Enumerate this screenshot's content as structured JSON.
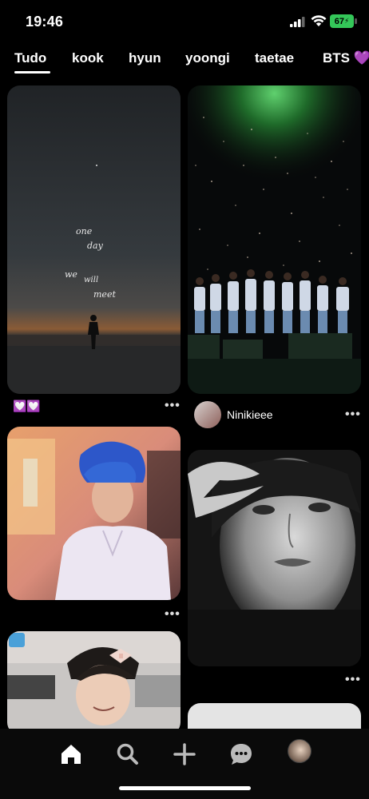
{
  "status_bar": {
    "time": "19:46",
    "battery": "67"
  },
  "tabs": [
    {
      "label": "Tudo"
    },
    {
      "label": "kook"
    },
    {
      "label": "hyun"
    },
    {
      "label": "yoongi"
    },
    {
      "label": "taetae"
    },
    {
      "label": "BTS 💜"
    }
  ],
  "pins": {
    "left_1": {
      "handwriting": [
        "one",
        "day",
        "we",
        "will",
        "meet"
      ],
      "emoji": "💟💟"
    },
    "right_1": {
      "author": "Ninikieee"
    }
  },
  "nav": {
    "items": [
      "home-icon",
      "search-icon",
      "plus-icon",
      "chat-icon",
      "profile-icon"
    ]
  }
}
